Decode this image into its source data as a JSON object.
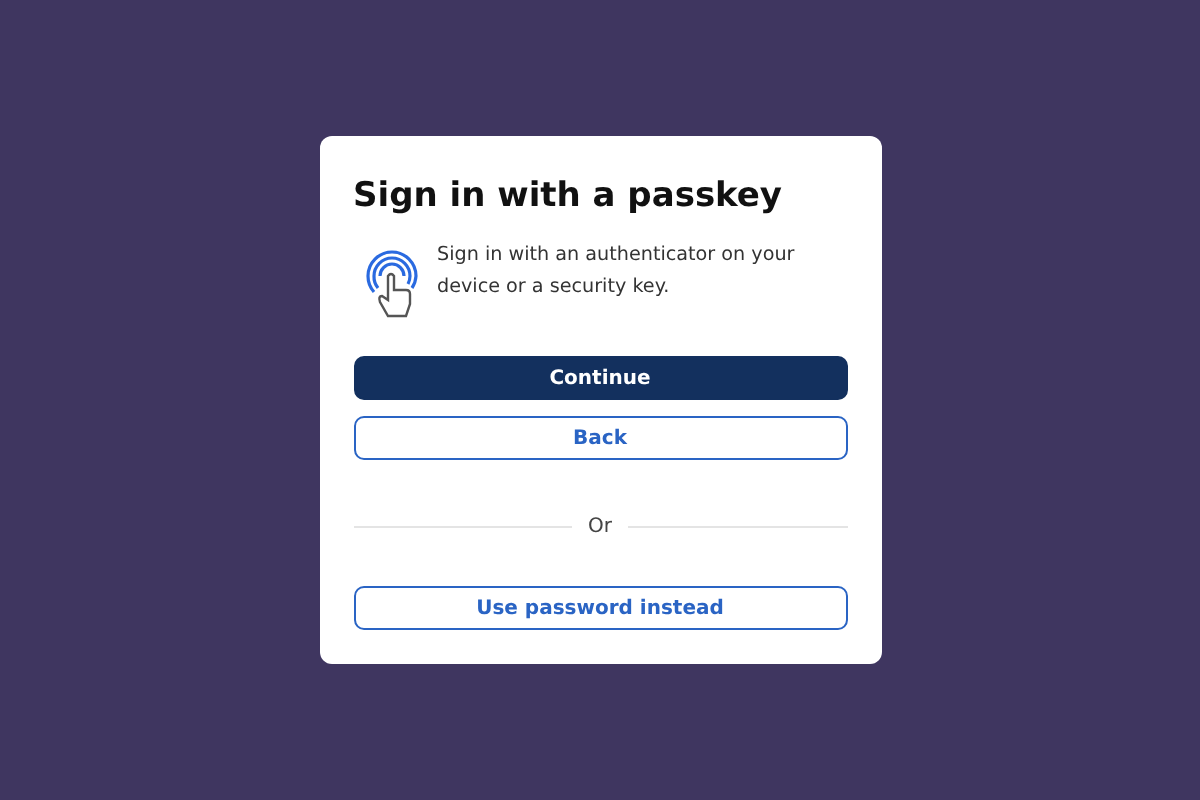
{
  "dialog": {
    "title": "Sign in with a passkey",
    "description": "Sign in with an authenticator on your device or a security key."
  },
  "buttons": [
    {
      "label": "Continue",
      "kind": "primary"
    },
    {
      "label": "Back",
      "kind": "outline"
    }
  ],
  "divider": {
    "label": "Or"
  },
  "alternate_buttons": [
    {
      "label": "Use password instead",
      "kind": "outline"
    }
  ]
}
